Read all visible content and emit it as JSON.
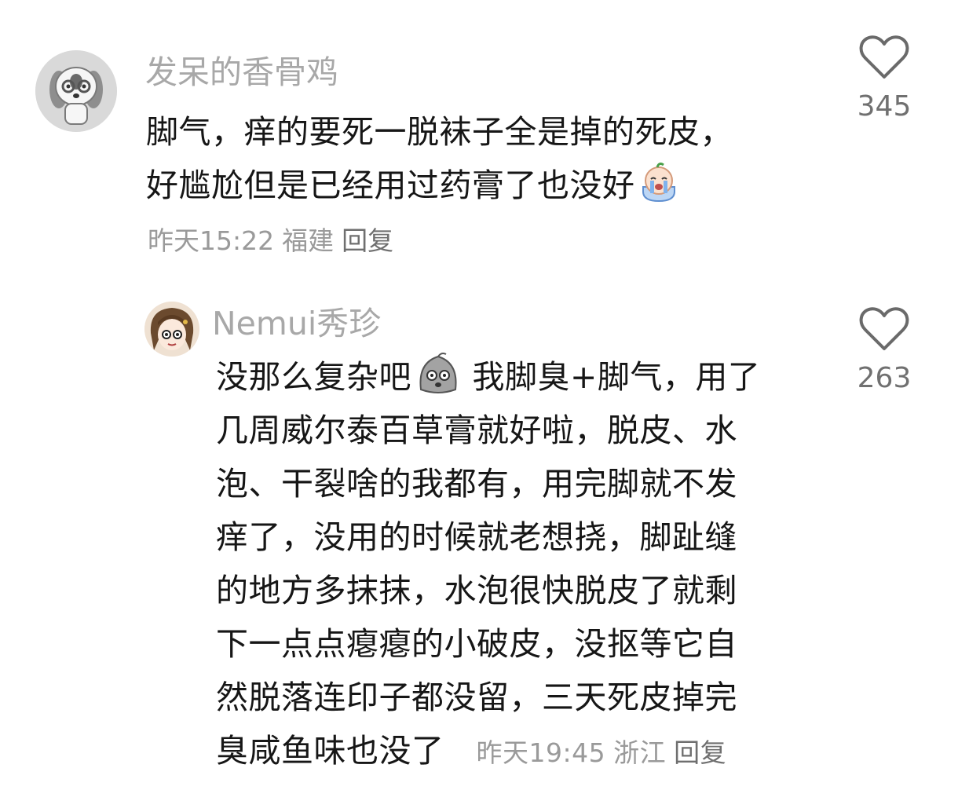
{
  "comments": [
    {
      "username": "发呆的香骨鸡",
      "text_line1": "脚气，痒的要死一脱袜子全是掉的死皮，",
      "text_line2": "好尴尬但是已经用过药膏了也没好",
      "emoji": "crying-face-emoji",
      "time": "昨天15:22",
      "region": "福建",
      "reply_label": "回复",
      "like_count": "345",
      "avatar": "dog-avatar"
    },
    {
      "username": "Nemui秀珍",
      "text_part1": "没那么复杂吧",
      "emoji": "zombie-face-emoji",
      "text_part2": " 我脚臭+脚气，用了",
      "lines": [
        "几周威尔泰百草膏就好啦，脱皮、水",
        "泡、干裂啥的我都有，用完脚就不发",
        "痒了，没用的时候就老想挠，脚趾缝",
        "的地方多抹抹，水泡很快脱皮了就剩",
        "下一点点瘪瘪的小破皮，没抠等它自",
        "然脱落连印子都没留，三天死皮掉完"
      ],
      "last_line": "臭咸鱼味也没了",
      "time": "昨天19:45",
      "region": "浙江",
      "reply_label": "回复",
      "like_count": "263",
      "avatar": "anime-girl-avatar"
    }
  ]
}
